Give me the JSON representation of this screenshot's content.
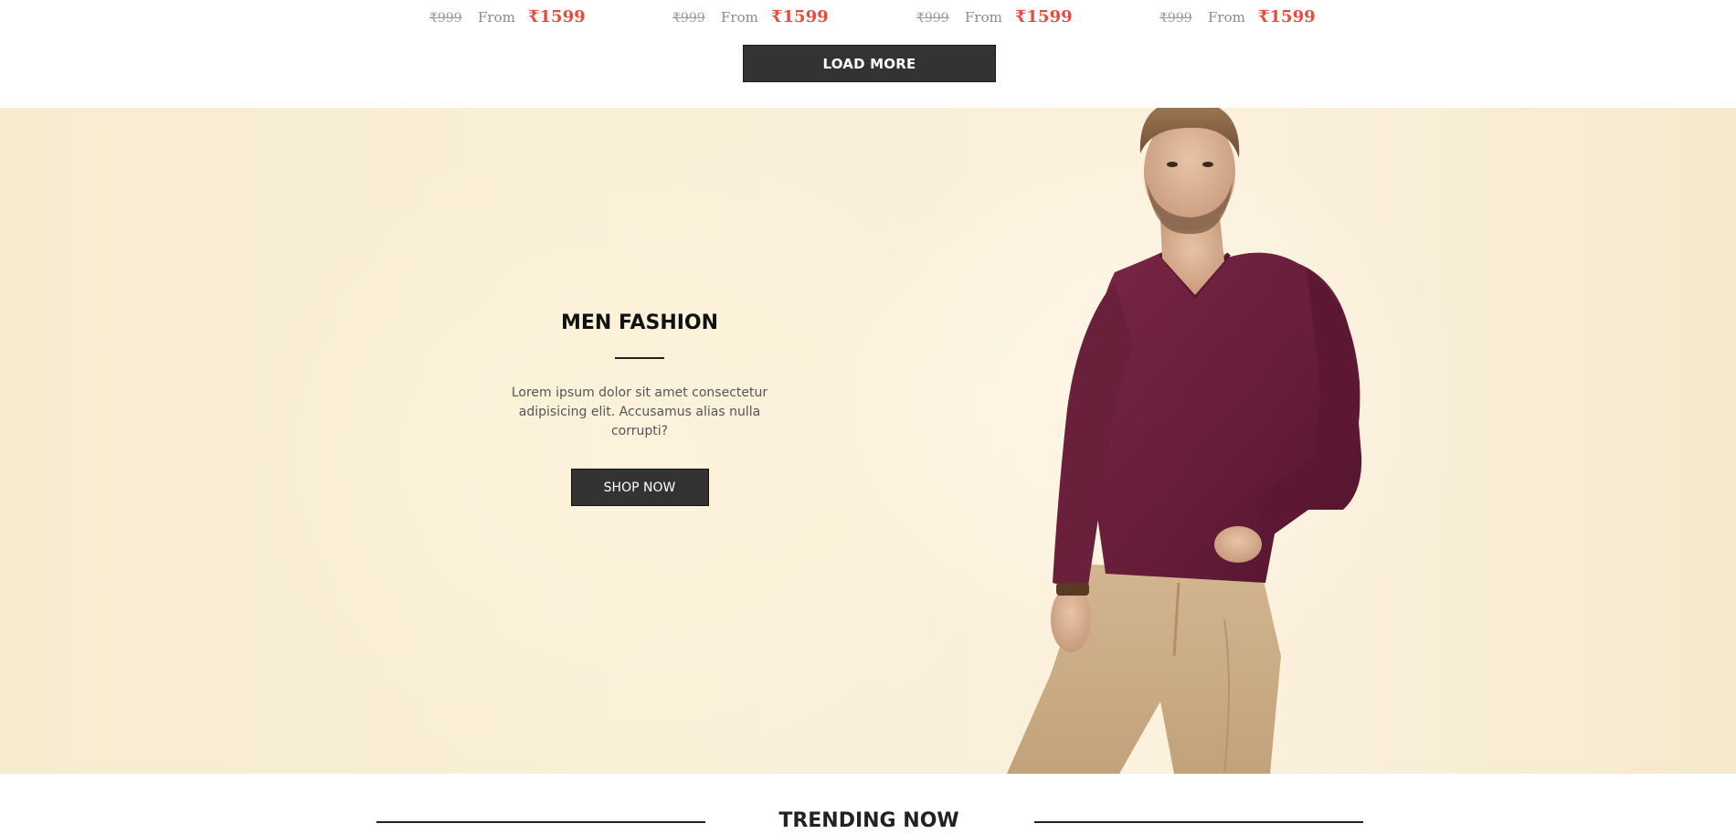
{
  "products": [
    {
      "old_price": "₹999",
      "from_label": "From",
      "price": "₹1599"
    },
    {
      "old_price": "₹999",
      "from_label": "From",
      "price": "₹1599"
    },
    {
      "old_price": "₹999",
      "from_label": "From",
      "price": "₹1599"
    },
    {
      "old_price": "₹999",
      "from_label": "From",
      "price": "₹1599"
    }
  ],
  "load_more": {
    "label": "LOAD MORE"
  },
  "hero": {
    "title": "MEN FASHION",
    "description": "Lorem ipsum dolor sit amet consectetur adipisicing elit. Accusamus alias nulla corrupti?",
    "cta_label": "SHOP NOW"
  },
  "trending": {
    "title": "TRENDING NOW"
  },
  "colors": {
    "price_accent": "#e84c3d",
    "button_bg": "#333333",
    "hero_bg": "#faf0d8",
    "sweater": "#6b1f3a",
    "trousers": "#cdb08a"
  }
}
